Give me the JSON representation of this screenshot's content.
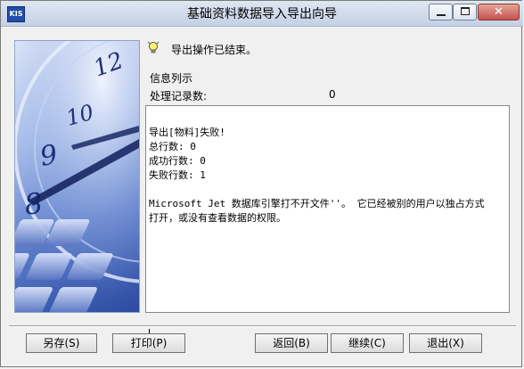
{
  "window": {
    "title": "基础资料数据导入导出向导",
    "app_icon_text": "KIS"
  },
  "title_buttons": {
    "close_glyph": "✕"
  },
  "status": "导出操作已结束。",
  "info_header": "信息列示",
  "records": {
    "label": "处理记录数:",
    "value": "0"
  },
  "log_lines": [
    "导出[物料]失败!",
    "总行数: 0",
    "成功行数: 0",
    "失败行数: 1",
    "",
    "Microsoft Jet 数据库引擎打不开文件''。  它已经被别的用户以独占方式",
    "打开，或没有查看数据的权限。"
  ],
  "buttons": {
    "save": "另存(S)",
    "print": "打印(P)",
    "back": "返回(B)",
    "next": "继续(C)",
    "exit": "退出(X)"
  },
  "colors": {
    "titlebar": "#cfd9ea",
    "close_button": "#c75050",
    "side_image_accent": "#2c4aa1"
  },
  "icons": {
    "wizard": "lightbulb-icon",
    "side": "clock-keyboard-image"
  }
}
